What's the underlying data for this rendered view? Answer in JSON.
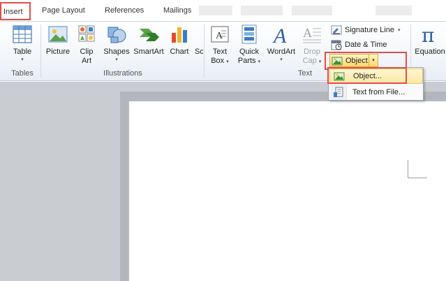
{
  "tabs": {
    "insert": "Insert",
    "page_layout": "Page Layout",
    "references": "References",
    "mailings": "Mailings"
  },
  "tables_group": {
    "table_label": "Table",
    "group_label": "Tables"
  },
  "illustrations_group": {
    "picture_label": "Picture",
    "clip_art_line1": "Clip",
    "clip_art_line2": "Art",
    "shapes_label": "Shapes",
    "smartart_label": "SmartArt",
    "chart_label": "Chart",
    "screenshot_partial": "Sc",
    "group_label": "Illustrations"
  },
  "text_group": {
    "text_box_line1": "Text",
    "text_box_line2": "Box",
    "quick_parts_line1": "Quick",
    "quick_parts_line2": "Parts",
    "wordart_label": "WordArt",
    "drop_cap_line1": "Drop",
    "drop_cap_line2": "Cap",
    "signature_line": "Signature Line",
    "date_time": "Date & Time",
    "object": "Object",
    "group_label": "Text"
  },
  "symbols_group": {
    "equation_label": "Equation"
  },
  "object_menu": {
    "items": [
      "Object...",
      "Text from File..."
    ]
  },
  "colors": {
    "highlight_red": "#e34b4b",
    "hover_gold": "#fbd96a"
  }
}
